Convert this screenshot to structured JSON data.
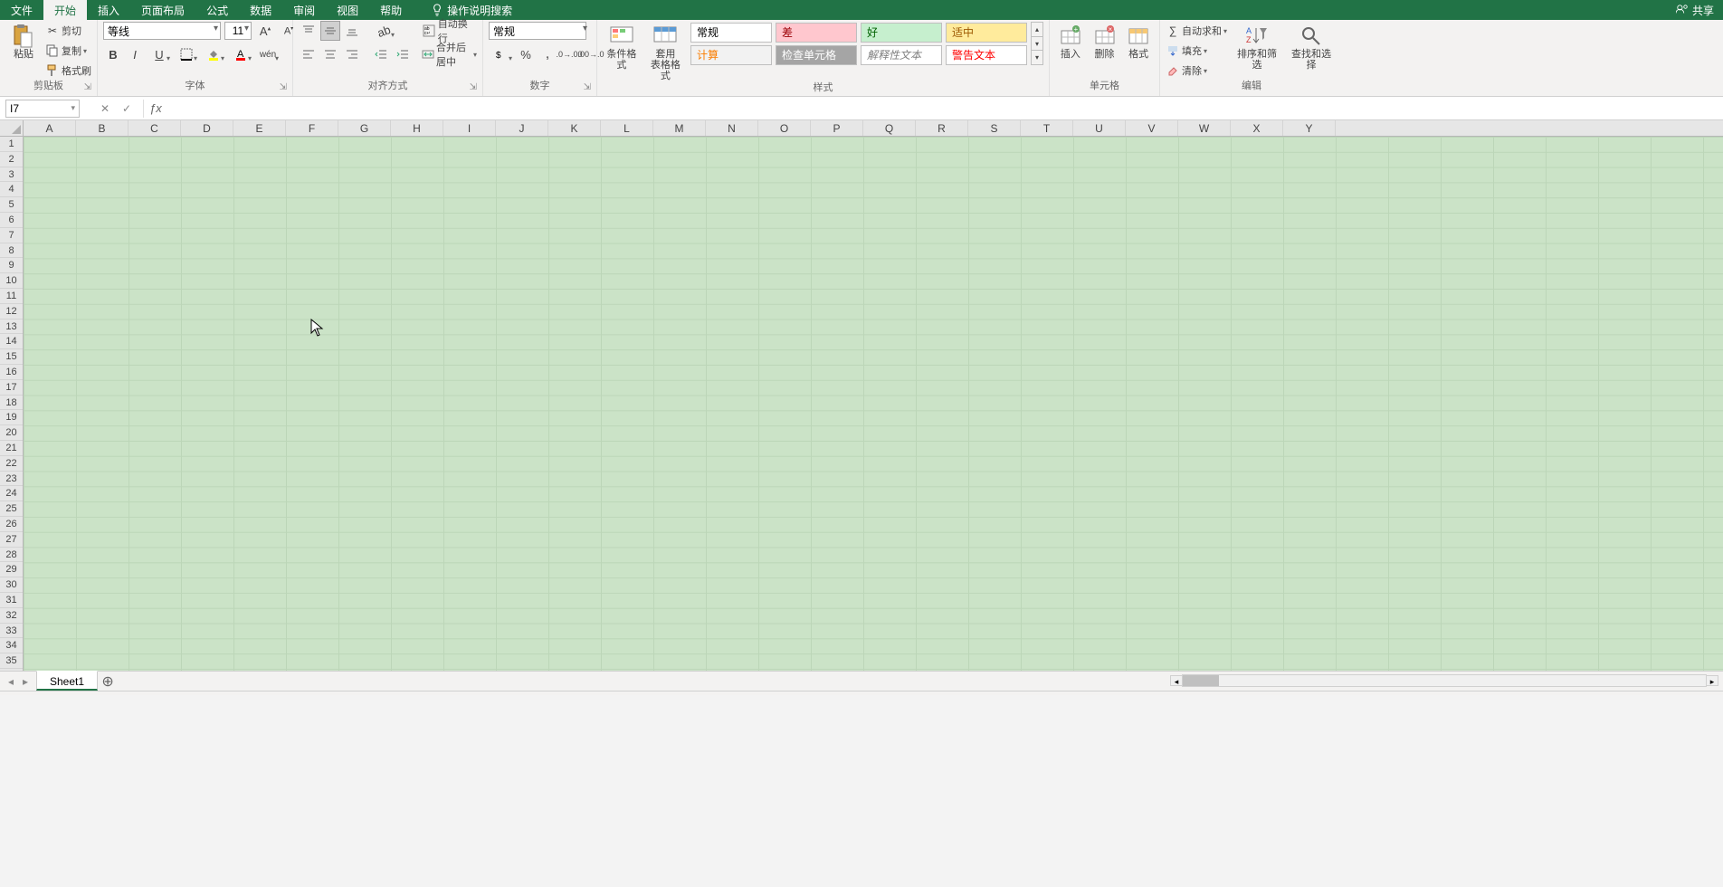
{
  "tabs": {
    "file": "文件",
    "home": "开始",
    "insert": "插入",
    "page_layout": "页面布局",
    "formulas": "公式",
    "data": "数据",
    "review": "审阅",
    "view": "视图",
    "help": "帮助",
    "tell_me": "操作说明搜索",
    "share": "共享"
  },
  "ribbon": {
    "clipboard": {
      "paste": "粘贴",
      "cut": "剪切",
      "copy": "复制",
      "format_painter": "格式刷",
      "label": "剪贴板"
    },
    "font": {
      "name": "等线",
      "size": "11",
      "label": "字体"
    },
    "alignment": {
      "wrap": "自动换行",
      "merge": "合并后居中",
      "label": "对齐方式"
    },
    "number": {
      "format": "常规",
      "label": "数字"
    },
    "styles": {
      "cond_format": "条件格式",
      "table_format1": "套用",
      "table_format2": "表格格式",
      "s_normal": "常规",
      "s_bad": "差",
      "s_good": "好",
      "s_neutral": "适中",
      "s_calc": "计算",
      "s_check": "检查单元格",
      "s_expl": "解释性文本",
      "s_warn": "警告文本",
      "label": "样式"
    },
    "cells": {
      "insert": "插入",
      "delete": "删除",
      "format": "格式",
      "label": "单元格"
    },
    "editing": {
      "autosum": "自动求和",
      "fill": "填充",
      "clear": "清除",
      "sort": "排序和筛选",
      "find": "查找和选择",
      "label": "编辑"
    }
  },
  "formula_bar": {
    "name_box": "I7",
    "value": ""
  },
  "columns": [
    "A",
    "B",
    "C",
    "D",
    "E",
    "F",
    "G",
    "H",
    "I",
    "J",
    "K",
    "L",
    "M",
    "N",
    "O",
    "P",
    "Q",
    "R",
    "S",
    "T",
    "U",
    "V",
    "W",
    "X",
    "Y"
  ],
  "rows": [
    "1",
    "2",
    "3",
    "4",
    "5",
    "6",
    "7",
    "8",
    "9",
    "10",
    "11",
    "12",
    "13",
    "14",
    "15",
    "16",
    "17",
    "18",
    "19",
    "20",
    "21",
    "22",
    "23",
    "24",
    "25",
    "26",
    "27",
    "28",
    "29",
    "30",
    "31",
    "32",
    "33",
    "34",
    "35"
  ],
  "sheet": {
    "name": "Sheet1"
  }
}
